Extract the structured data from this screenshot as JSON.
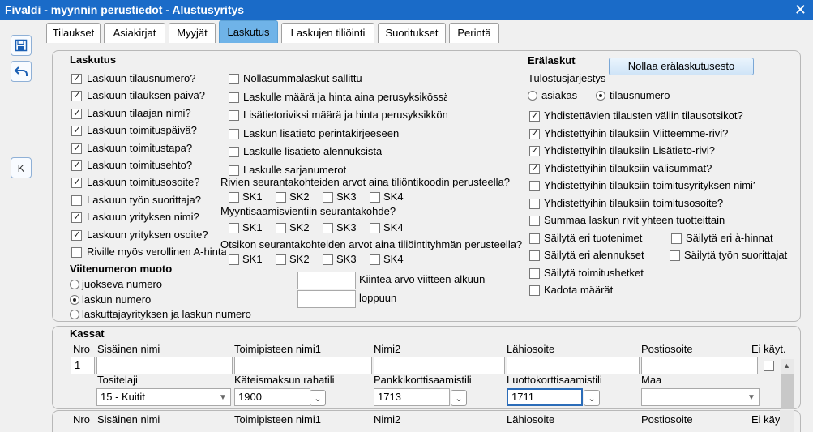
{
  "window": {
    "title": "Fivaldi - myynnin perustiedot - Alustusyritys",
    "close_glyph": "✕"
  },
  "sidebar": {
    "k_label": "K"
  },
  "tabs": [
    {
      "label": "Tilaukset",
      "active": false
    },
    {
      "label": "Asiakirjat",
      "active": false
    },
    {
      "label": "Myyjät",
      "active": false
    },
    {
      "label": "Laskutus",
      "active": true
    },
    {
      "label": "Laskujen tiliöinti",
      "active": false
    },
    {
      "label": "Suoritukset",
      "active": false
    },
    {
      "label": "Perintä",
      "active": false
    }
  ],
  "laskutus": {
    "heading": "Laskutus",
    "col1": [
      {
        "label": "Laskuun tilausnumero?",
        "checked": true
      },
      {
        "label": "Laskuun tilauksen päivä?",
        "checked": true
      },
      {
        "label": "Laskuun tilaajan nimi?",
        "checked": true
      },
      {
        "label": "Laskuun toimituspäivä?",
        "checked": true
      },
      {
        "label": "Laskuun toimitustapa?",
        "checked": true
      },
      {
        "label": "Laskuun toimitusehto?",
        "checked": true
      },
      {
        "label": "Laskuun toimitusosoite?",
        "checked": true
      },
      {
        "label": "Laskuun työn suorittaja?",
        "checked": false
      },
      {
        "label": "Laskuun yrityksen nimi?",
        "checked": true
      },
      {
        "label": "Laskuun yrityksen osoite?",
        "checked": true
      },
      {
        "label": "Riville myös verollinen A-hinta?",
        "checked": false
      }
    ],
    "col2": [
      {
        "label": "Nollasummalaskut sallittu",
        "checked": false
      },
      {
        "label": "Laskulle määrä ja hinta aina perusyksikössä",
        "checked": false
      },
      {
        "label": "Lisätietoriviksi määrä ja hinta perusyksikkönä",
        "checked": false
      },
      {
        "label": "Laskun lisätieto perintäkirjeeseen",
        "checked": false
      },
      {
        "label": "Laskulle lisätieto alennuksista",
        "checked": false
      },
      {
        "label": "Laskulle sarjanumerot",
        "checked": false
      }
    ],
    "rivien_label": "Rivien seurantakohteiden arvot aina tiliöntikoodin perusteella?",
    "myynti_label": "Myyntisaamisvientiin seurantakohde?",
    "otsikon_label": "Otsikon seurantakohteiden arvot aina tiliöintityhmän  perusteella?",
    "sk": [
      "SK1",
      "SK2",
      "SK3",
      "SK4"
    ],
    "viite_heading": "Viitenumeron muoto",
    "viite_options": [
      {
        "label": "juokseva numero",
        "selected": false
      },
      {
        "label": "laskun numero",
        "selected": true
      },
      {
        "label": "laskuttajayrityksen ja laskun numero",
        "selected": false
      }
    ],
    "kiintea_label": "Kiinteä arvo viitteen alkuun",
    "loppuun_label": "loppuun",
    "kiintea_value": "",
    "loppuun_value": ""
  },
  "eralaskut": {
    "heading": "Erälaskut",
    "reset_button": "Nollaa erälaskutusesto",
    "tulostus_label": "Tulostusjärjestys",
    "tulostus_options": [
      {
        "label": "asiakas",
        "selected": false
      },
      {
        "label": "tilausnumero",
        "selected": true
      }
    ],
    "checks": [
      {
        "label": "Yhdistettävien tilausten väliin tilausotsikot?",
        "checked": true
      },
      {
        "label": "Yhdistettyihin tilauksiin Viitteemme-rivi?",
        "checked": true
      },
      {
        "label": "Yhdistettyihin tilauksiin Lisätieto-rivi?",
        "checked": true
      },
      {
        "label": "Yhdistettyihin tilauksiin välisummat?",
        "checked": true
      },
      {
        "label": "Yhdistettyihin tilauksiin toimitusyrityksen nimi?",
        "checked": false
      },
      {
        "label": "Yhdistettyihin tilauksiin toimitusosoite?",
        "checked": false
      },
      {
        "label": "Summaa laskun rivit yhteen tuotteittain",
        "checked": false
      }
    ],
    "pairs": [
      {
        "left": "Säilytä eri tuotenimet",
        "left_checked": false,
        "right": "Säilytä eri à-hinnat",
        "right_checked": false
      },
      {
        "left": "Säilytä eri alennukset",
        "left_checked": false,
        "right": "Säilytä työn suorittajat",
        "right_checked": false
      }
    ],
    "singles": [
      {
        "label": "Säilytä toimitushetket",
        "checked": false
      },
      {
        "label": "Kadota määrät",
        "checked": false
      }
    ]
  },
  "kassat": {
    "heading": "Kassat",
    "headers": [
      "Nro",
      "Sisäinen nimi",
      "Toimipisteen nimi1",
      "Nimi2",
      "Lähiosoite",
      "Postiosoite",
      "Ei käyt."
    ],
    "subheaders": [
      "Tositelaji",
      "Käteismaksun rahatili",
      "Pankkikorttisaamistili",
      "Luottokorttisaamistili",
      "Maa"
    ],
    "row1": {
      "nro": "1",
      "sisainen": "",
      "toimipiste": "",
      "nimi2": "",
      "lahiosoite": "",
      "postiosoite": "",
      "tositelaji": "15 - Kuitit",
      "kateis": "1900",
      "pankki": "1713",
      "luotto": "1711",
      "maa": ""
    },
    "headers2": [
      "Nro",
      "Sisäinen nimi",
      "Toimipisteen nimi1",
      "Nimi2",
      "Lähiosoite",
      "Postiosoite",
      "Ei käyt."
    ]
  }
}
